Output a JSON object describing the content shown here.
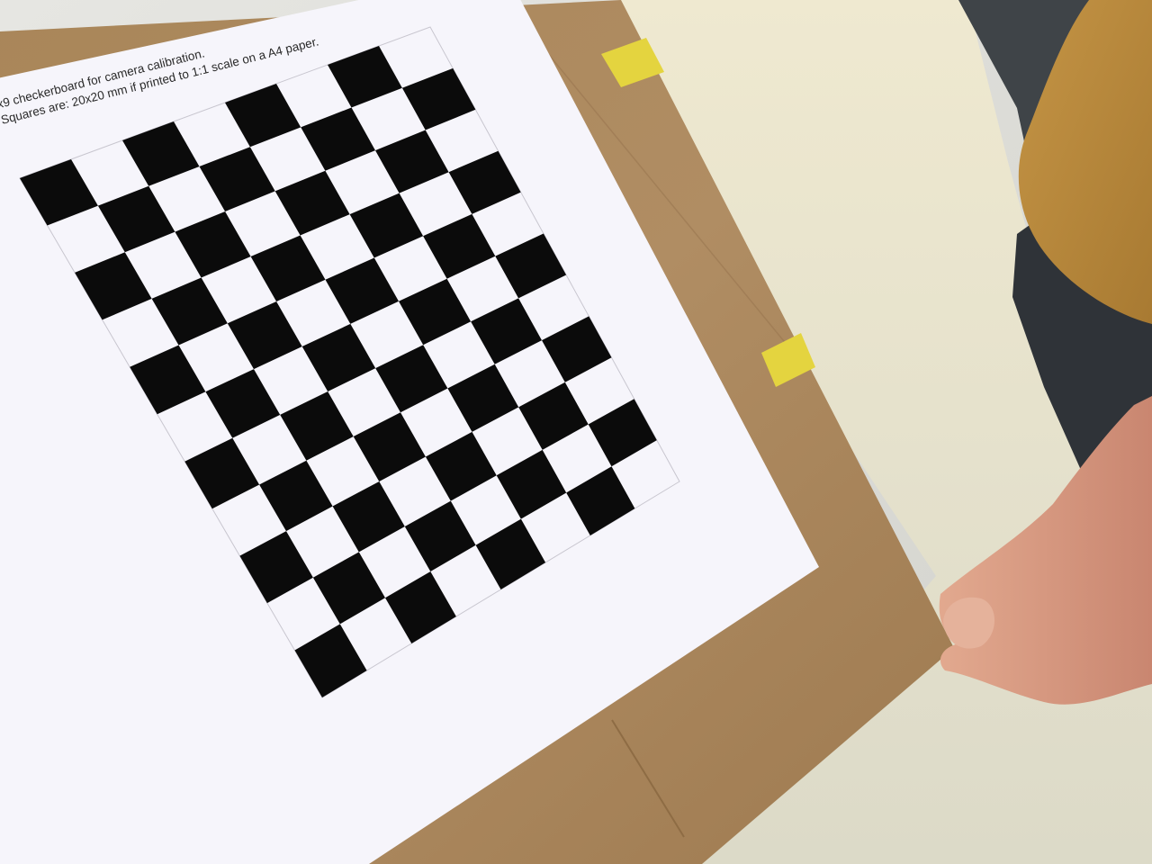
{
  "photo": {
    "subject": "checkerboard",
    "caption": {
      "line1": "x9 checkerboard for camera calibration.",
      "line2": "Squares are: 20x20 mm if printed to 1:1 scale on a A4 paper."
    },
    "board": {
      "cols": 8,
      "rows": 11,
      "square_color": "#0b0b0b",
      "paper_color": "#f6f5fb"
    },
    "colors": {
      "wall": "#e7e2c9",
      "cardboard": "#b08d63",
      "tape": "#e2d23c",
      "shirt": "#b98a3c",
      "skin": "#d89a80"
    }
  }
}
